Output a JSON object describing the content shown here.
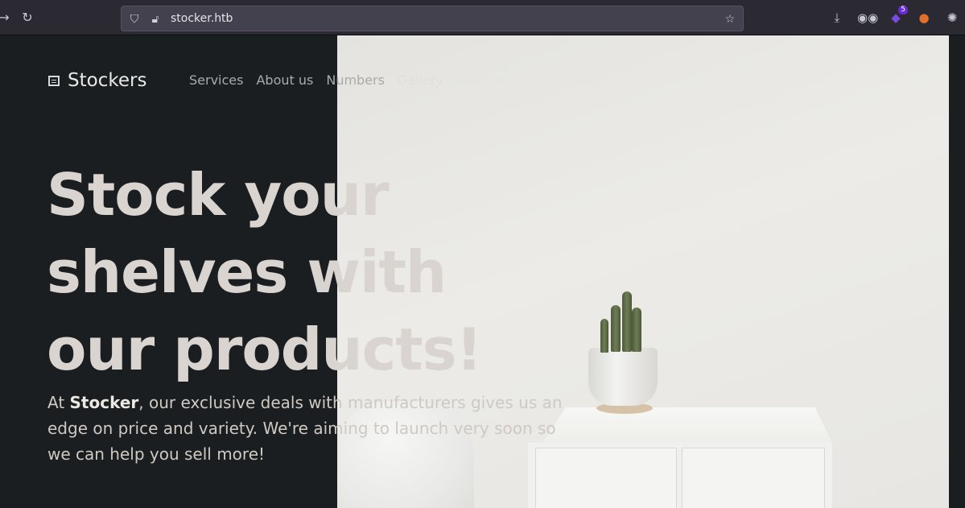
{
  "browser": {
    "url": "stocker.htb",
    "extension_badge": "5",
    "icons": [
      "back-arrow-icon",
      "reload-icon",
      "shield-icon",
      "lock-insecure-icon",
      "star-icon",
      "download-icon",
      "binoculars-icon",
      "extension-cube-icon",
      "flame-icon",
      "cookie-icon"
    ]
  },
  "site": {
    "brand": "Stockers",
    "nav": [
      "Services",
      "About us",
      "Numbers",
      "Gallery",
      "Work with us",
      "Contact"
    ],
    "headline": [
      "Stock your",
      "shelves with",
      "our products!"
    ],
    "tagline_prefix": "At ",
    "tagline_brand": "Stocker",
    "tagline_rest": ", our exclusive deals with manufacturers gives us an edge on price and variety. We're aiming to launch very soon so we can help you sell more!"
  },
  "colors": {
    "page_bg": "#1b1e20",
    "headline": "#d9d4cf",
    "nav_text": "#a9abab",
    "hero_image_wall": "#e7e6e2"
  }
}
